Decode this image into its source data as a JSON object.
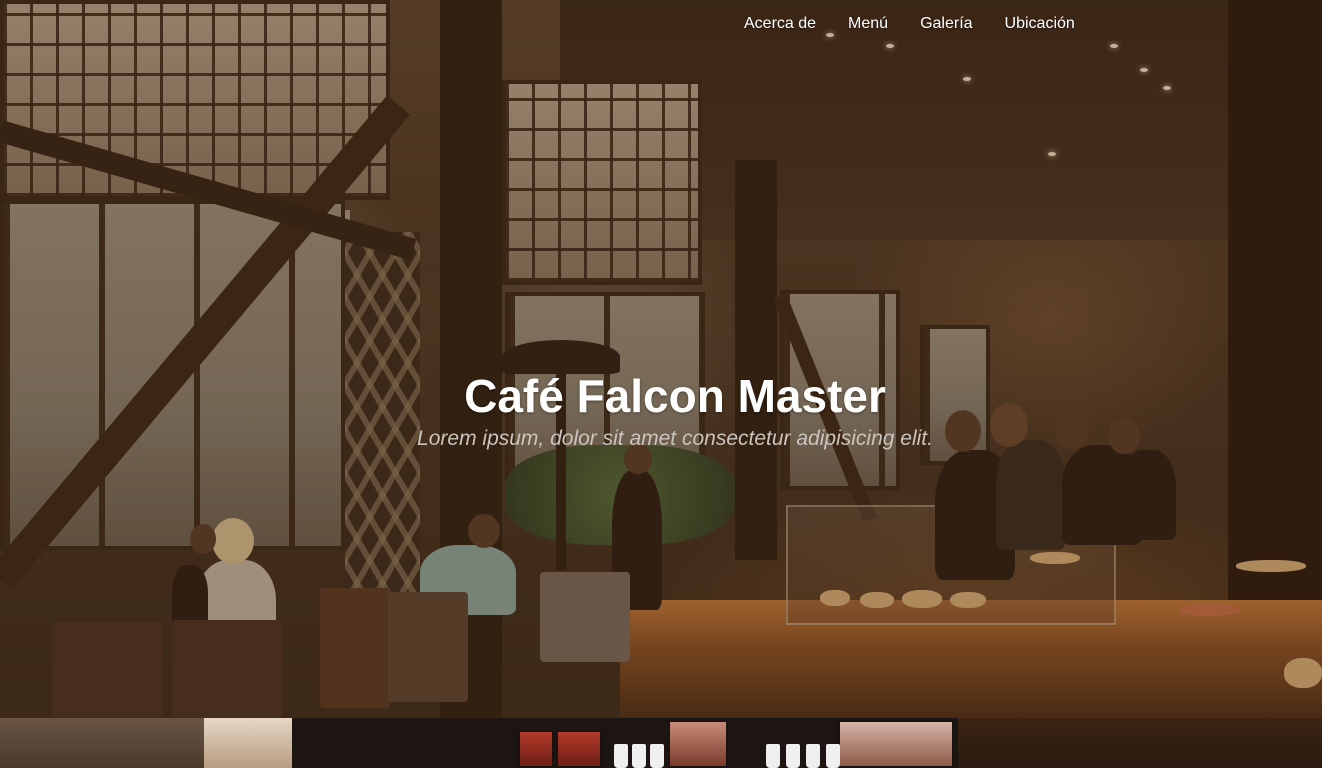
{
  "nav": {
    "items": [
      {
        "label": "Acerca de"
      },
      {
        "label": "Menú"
      },
      {
        "label": "Galería"
      },
      {
        "label": "Ubicación"
      }
    ]
  },
  "hero": {
    "title": "Café Falcon Master",
    "subtitle": "Lorem ipsum, dolor sit amet consectetur adipisicing elit."
  },
  "colors": {
    "nav_text": "#ffffff",
    "title_text": "#ffffff",
    "subtitle_text": "#c9c4be",
    "hero_tint": "#5e4630"
  }
}
